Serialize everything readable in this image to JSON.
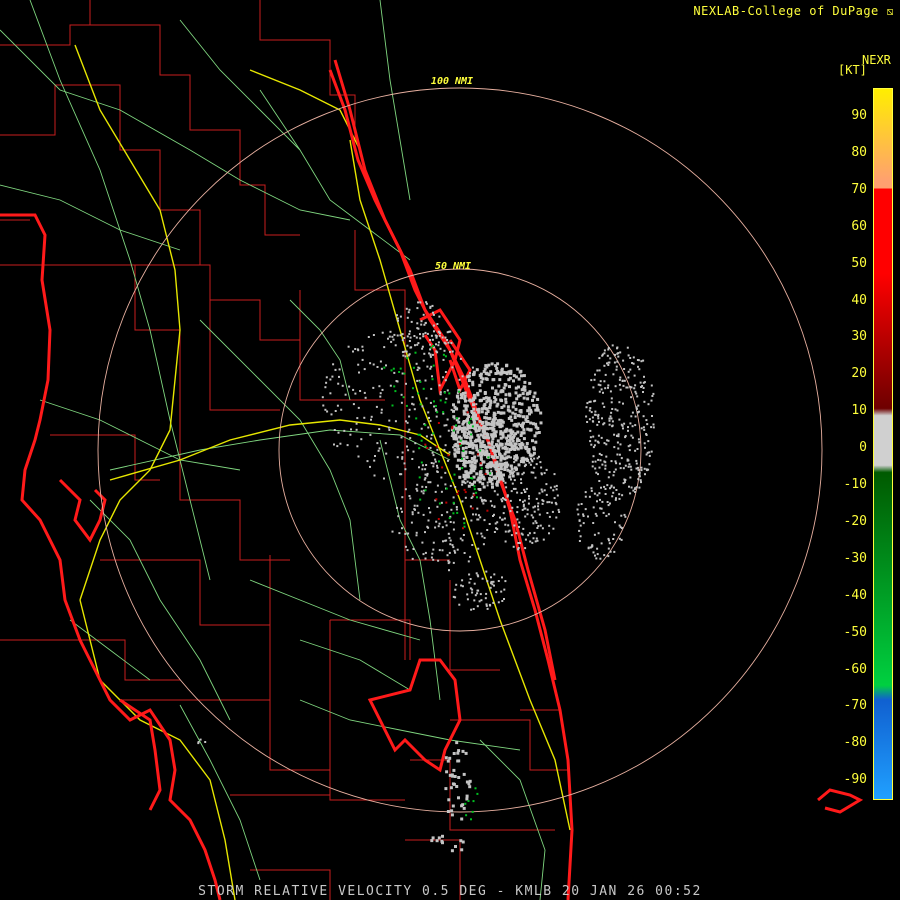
{
  "header": {
    "credit": "NEXLAB-College of DuPage"
  },
  "footer": {
    "product": "STORM RELATIVE VELOCITY 0.5 DEG - KMLB 20 JAN 26 00:52"
  },
  "legend": {
    "title": "NEXR",
    "unit": "[KT]",
    "ticks": [
      "90",
      "80",
      "70",
      "60",
      "50",
      "40",
      "30",
      "20",
      "10",
      "0",
      "-10",
      "-20",
      "-30",
      "-40",
      "-50",
      "-60",
      "-70",
      "-80",
      "-90"
    ],
    "colors": {
      "top": "#ffee00",
      "orange": "#ffa070",
      "red": "#ff0000",
      "darkred": "#6e0000",
      "gray": "#d0d0d0",
      "darkgreen": "#005a00",
      "green": "#00d040",
      "blue": "#1060d0",
      "cyan": "#20a0ff"
    }
  },
  "range_rings": [
    {
      "label": "100 NMI"
    },
    {
      "label": "50 NMI"
    }
  ],
  "map_colors": {
    "coastline": "#ff1a1a",
    "county": "#c81e1e",
    "highway": "#e6e600",
    "road": "#7fd67f",
    "ring": "#e8b0a0",
    "echo_gray": "#c4c4c4",
    "echo_green": "#00c020",
    "echo_red": "#c00000"
  }
}
